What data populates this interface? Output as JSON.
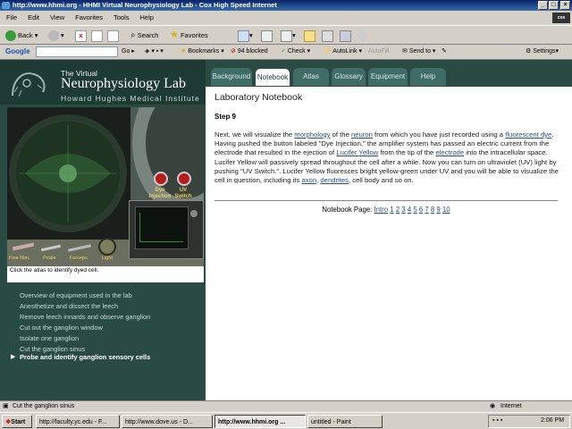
{
  "window": {
    "title": "http://www.hhmi.org - HHMI Virtual Neurophysiology Lab - Cox High Speed Internet",
    "isp_logo": "cox"
  },
  "menu": [
    "File",
    "Edit",
    "View",
    "Favorites",
    "Tools",
    "Help"
  ],
  "toolbar": {
    "back": "Back",
    "search": "Search",
    "favorites": "Favorites"
  },
  "googlebar": {
    "label": "Google",
    "go": "Go",
    "bookmarks": "Bookmarks",
    "blocked": "94 blocked",
    "check": "Check",
    "autolink": "AutoLink",
    "autofill": "AutoFill",
    "sendto": "Send to",
    "settings": "Settings"
  },
  "site": {
    "title_small": "The Virtual",
    "title_big": "Neurophysiology Lab",
    "subtitle": "Howard Hughes Medical Institute"
  },
  "tabs": [
    "Background",
    "Notebook",
    "Atlas",
    "Glossary",
    "Equipment",
    "Help"
  ],
  "sim": {
    "dye_label": "Dye Injection",
    "uv_label": "UV Switch",
    "tools": [
      "Fine Nim.",
      "Probe",
      "Forceps",
      "Light"
    ],
    "caption": "Click the atlas to identify dyed cell."
  },
  "nav": [
    "Overview of equipment used in the lab",
    "Anesthetize and dissect the leech",
    "Remove leech innards and observe ganglion",
    "Cut out the ganglion window",
    "Isolate one ganglion",
    "Cut the ganglion sinus",
    "Probe and identify ganglion sensory cells"
  ],
  "notebook": {
    "title": "Laboratory Notebook",
    "step": "Step 9",
    "p1": "Next, we will visualize the ",
    "l_morphology": "morphology",
    "p2": " of the ",
    "l_neuron": "neuron",
    "p3": " from which you have just recorded using a ",
    "l_dye": "fluorescent dye",
    "p4": ". Having pushed the button labeled \"Dye Injection,\" the amplifier system has passed an electric current from the electrode that resulted in the ejection of ",
    "l_lucifer": "Lucifer Yellow",
    "p5": " from the tip of the ",
    "l_electrode": "electrode",
    "p6": " into the intracellular space. Lucifer Yellow will passively spread throughout the cell after a while. Now you can turn on ultraviolet (UV) light by pushing \"UV Switch.\". Lucifer Yellow fluoresces bright yellow-green under UV and you will be able to visualize the cell in question, including its ",
    "l_axon": "axon",
    "p7": ", ",
    "l_dendrites": "dendrites",
    "p8": ", cell body and so on.",
    "pager_label": "Notebook Page:",
    "pages": [
      "Intro",
      "1",
      "2",
      "3",
      "4",
      "5",
      "6",
      "7",
      "8",
      "9",
      "10"
    ]
  },
  "status": {
    "text": "Cut the ganglion sinus",
    "zone": "Internet"
  },
  "taskbar": {
    "start": "Start",
    "tasks": [
      "http://faculty.yc.edu - F...",
      "http://www.dove.us - D...",
      "http://www.hhmi.org ...",
      "untitled - Paint"
    ],
    "clock": "2:06 PM"
  },
  "colors": {
    "panel": "#2a4a44",
    "tab": "#3f6d66",
    "link": "#2a4e8a"
  }
}
